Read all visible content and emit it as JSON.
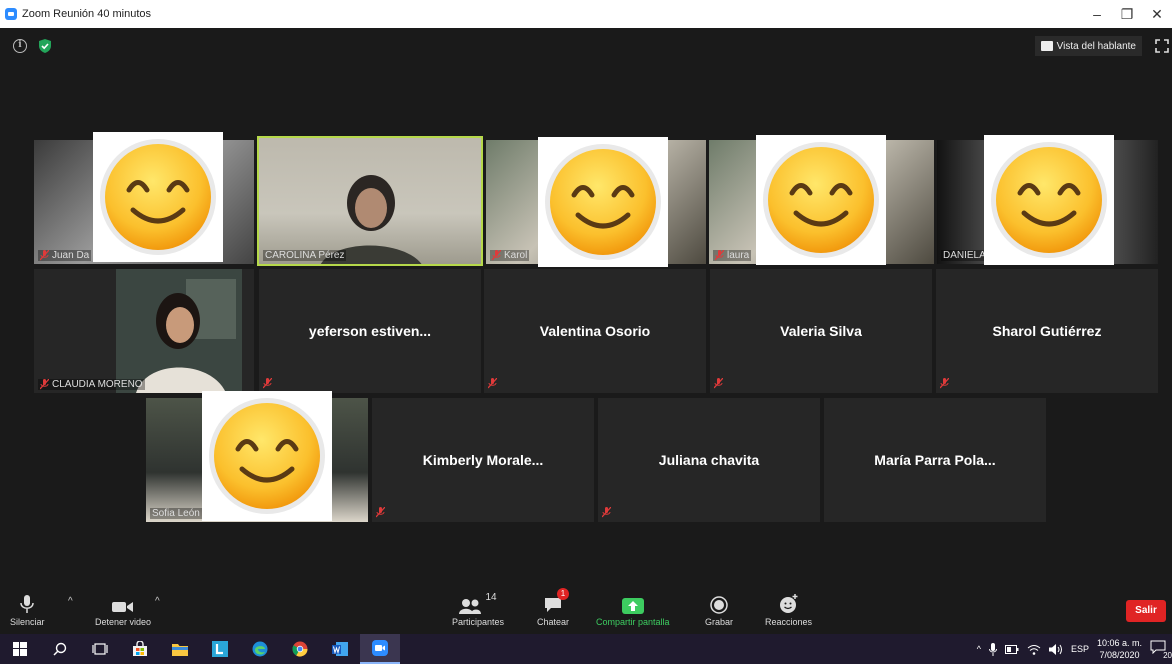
{
  "window": {
    "title": "Zoom Reunión 40 minutos"
  },
  "topbar": {
    "speaker_view_label": "Vista del hablante"
  },
  "participants_tiles": [
    {
      "name": "Juan Da",
      "muted": true,
      "has_video": true
    },
    {
      "name": "CAROLINA Pérez",
      "muted": false,
      "has_video": true,
      "active_speaker": true
    },
    {
      "name": "Karol",
      "muted": true,
      "has_video": true
    },
    {
      "name": "laura",
      "muted": true,
      "has_video": true
    },
    {
      "name": "DANIELA",
      "muted": false,
      "has_video": true
    },
    {
      "name": "CLAUDIA MORENO",
      "muted": true,
      "has_video": true
    },
    {
      "name": "yeferson estiven...",
      "muted": true,
      "has_video": false
    },
    {
      "name": "Valentina Osorio",
      "muted": true,
      "has_video": false
    },
    {
      "name": "Valeria Silva",
      "muted": true,
      "has_video": false
    },
    {
      "name": "Sharol Gutiérrez",
      "muted": true,
      "has_video": false
    },
    {
      "name": "Sofia León",
      "muted": false,
      "has_video": true
    },
    {
      "name": "Kimberly Morale...",
      "muted": true,
      "has_video": false
    },
    {
      "name": "Juliana chavita",
      "muted": true,
      "has_video": false
    },
    {
      "name": "María Parra Pola...",
      "muted": false,
      "has_video": false
    }
  ],
  "toolbar": {
    "mute_label": "Silenciar",
    "video_label": "Detener video",
    "participants_label": "Participantes",
    "participants_count": "14",
    "chat_label": "Chatear",
    "chat_badge": "1",
    "share_label": "Compartir pantalla",
    "record_label": "Grabar",
    "reactions_label": "Reacciones",
    "leave_label": "Salir"
  },
  "taskbar": {
    "language": "ESP",
    "time": "10:06 a. m.",
    "date": "7/08/2020",
    "notification_count": "20"
  },
  "colors": {
    "active_speaker_border": "#b6d94a",
    "share_green": "#3dcc60",
    "leave_red": "#e02424",
    "zoom_blue": "#2d8cff"
  }
}
